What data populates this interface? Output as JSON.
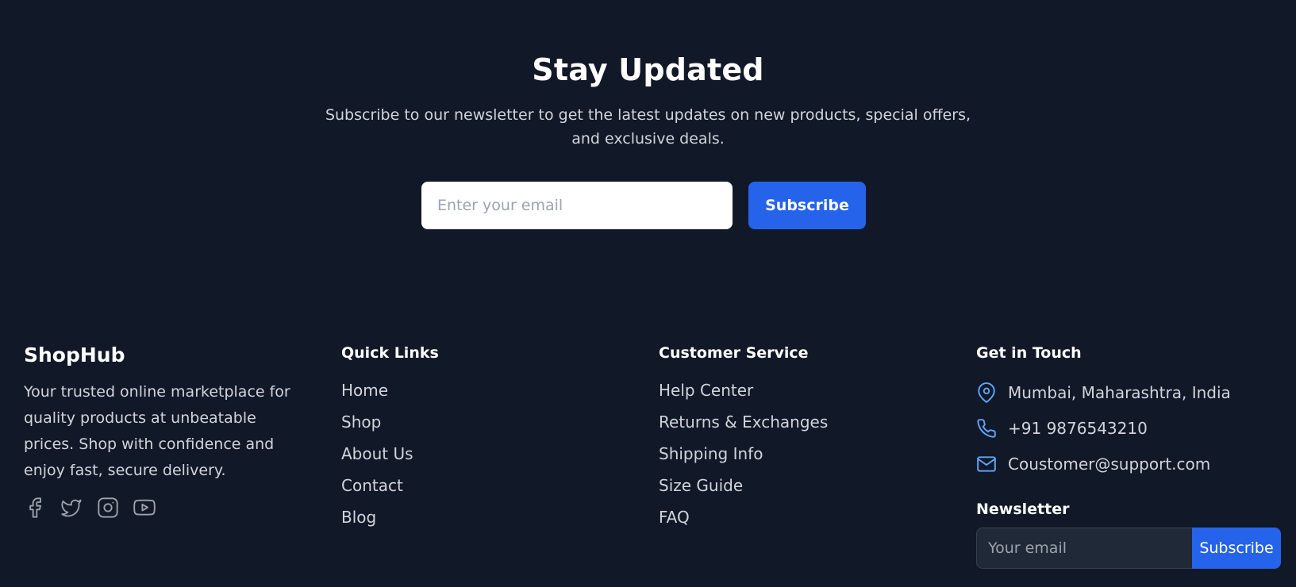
{
  "hero": {
    "title": "Stay Updated",
    "subtitle": "Subscribe to our newsletter to get the latest updates on new products, special offers, and exclusive deals.",
    "email_placeholder": "Enter your email",
    "subscribe_label": "Subscribe"
  },
  "brand": {
    "name": "ShopHub",
    "description": "Your trusted online marketplace for quality products at unbeatable prices. Shop with confidence and enjoy fast, secure delivery.",
    "socials": [
      {
        "icon": "facebook-icon"
      },
      {
        "icon": "twitter-icon"
      },
      {
        "icon": "instagram-icon"
      },
      {
        "icon": "youtube-icon"
      }
    ]
  },
  "quick_links": {
    "heading": "Quick Links",
    "items": [
      "Home",
      "Shop",
      "About Us",
      "Contact",
      "Blog"
    ]
  },
  "customer_service": {
    "heading": "Customer Service",
    "items": [
      "Help Center",
      "Returns & Exchanges",
      "Shipping Info",
      "Size Guide",
      "FAQ"
    ]
  },
  "contact": {
    "heading": "Get in Touch",
    "items": [
      {
        "icon": "location-pin-icon",
        "text": "Mumbai, Maharashtra, India"
      },
      {
        "icon": "phone-icon",
        "text": "+91 9876543210"
      },
      {
        "icon": "mail-icon",
        "text": "Coustomer@support.com"
      }
    ]
  },
  "footer_newsletter": {
    "heading": "Newsletter",
    "placeholder": "Your email",
    "button_label": "Subscribe"
  },
  "colors": {
    "background": "#111827",
    "accent": "#2563eb",
    "icon_blue": "#60a5fa",
    "muted_text": "#d1d5db",
    "social_icon": "#9ca3af"
  }
}
